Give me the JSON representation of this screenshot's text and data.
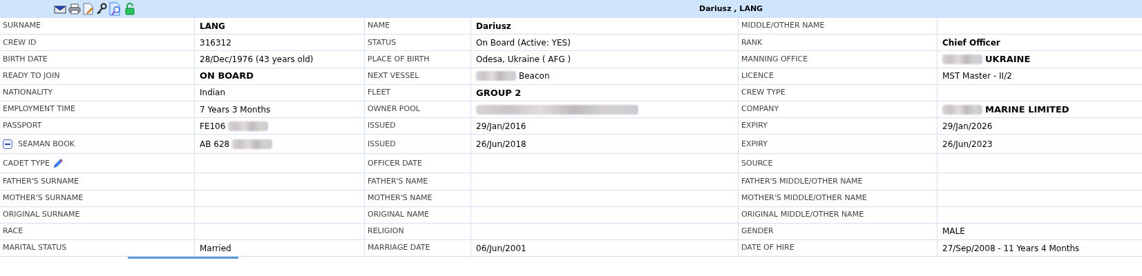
{
  "header": {
    "title": "Dariusz , LANG"
  },
  "rows": [
    [
      {
        "label": "SURNAME",
        "value": "LANG",
        "bold": true
      },
      {
        "label": "NAME",
        "value": "Dariusz",
        "bold": true
      },
      {
        "label": "MIDDLE/OTHER NAME"
      }
    ],
    [
      {
        "label": "CREW ID",
        "value": "316312"
      },
      {
        "label": "STATUS",
        "value": "On Board (Active: YES)"
      },
      {
        "label": "RANK",
        "value": "Chief Officer",
        "bold": true
      }
    ],
    [
      {
        "label": "BIRTH DATE",
        "value": "28/Dec/1976 (43 years old)"
      },
      {
        "label": "PLACE OF BIRTH",
        "value": "Odesa, Ukraine ( AFG )"
      },
      {
        "label": "MANNING OFFICE",
        "value": "UKRAINE",
        "bold": true,
        "large": true,
        "redacted_before": true
      }
    ],
    [
      {
        "label": "READY TO JOIN",
        "value": "ON BOARD",
        "bold": true,
        "large": true
      },
      {
        "label": "NEXT VESSEL",
        "value": "Beacon",
        "redacted_before": true
      },
      {
        "label": "LICENCE",
        "value": "MST Master - II/2"
      }
    ],
    [
      {
        "label": "NATIONALITY",
        "value": "Indian"
      },
      {
        "label": "FLEET",
        "value": "GROUP 2",
        "bold": true,
        "large": true
      },
      {
        "label": "CREW TYPE"
      }
    ],
    [
      {
        "label": "EMPLOYMENT TIME",
        "value": "7 Years 3 Months"
      },
      {
        "label": "OWNER POOL",
        "redacted_before": true
      },
      {
        "label": "COMPANY",
        "value": "MARINE LIMITED",
        "bold": true,
        "large": true,
        "redacted_before": true
      }
    ],
    [
      {
        "label": "PASSPORT",
        "value": "FE106",
        "redacted_after": true
      },
      {
        "label": "ISSUED",
        "value": "29/Jan/2016"
      },
      {
        "label": "EXPIRY",
        "value": "29/Jan/2026"
      }
    ],
    [
      {
        "label": "SEAMAN BOOK",
        "collapsible": true,
        "value": "AB 628",
        "redacted_after": true
      },
      {
        "label": "ISSUED",
        "value": "26/Jun/2018"
      },
      {
        "label": "EXPIRY",
        "value": "26/Jun/2023"
      }
    ],
    [
      {
        "label": "CADET TYPE",
        "editable": true
      },
      {
        "label": "OFFICER DATE"
      },
      {
        "label": "SOURCE"
      }
    ],
    [
      {
        "label": "FATHER'S SURNAME"
      },
      {
        "label": "FATHER'S NAME"
      },
      {
        "label": "FATHER'S MIDDLE/OTHER NAME"
      }
    ],
    [
      {
        "label": "MOTHER'S SURNAME"
      },
      {
        "label": "MOTHER'S NAME"
      },
      {
        "label": "MOTHER'S MIDDLE/OTHER NAME"
      }
    ],
    [
      {
        "label": "ORIGINAL SURNAME"
      },
      {
        "label": "ORIGINAL NAME"
      },
      {
        "label": "ORIGINAL MIDDLE/OTHER NAME"
      }
    ],
    [
      {
        "label": "RACE"
      },
      {
        "label": "RELIGION"
      },
      {
        "label": "GENDER",
        "value": "MALE"
      }
    ],
    [
      {
        "label": "MARITAL STATUS",
        "value": "Married"
      },
      {
        "label": "MARRIAGE DATE",
        "value": "06/Jun/2001"
      },
      {
        "label": "DATE OF HIRE",
        "value": "27/Sep/2008 - 11 Years 4 Months"
      }
    ]
  ]
}
